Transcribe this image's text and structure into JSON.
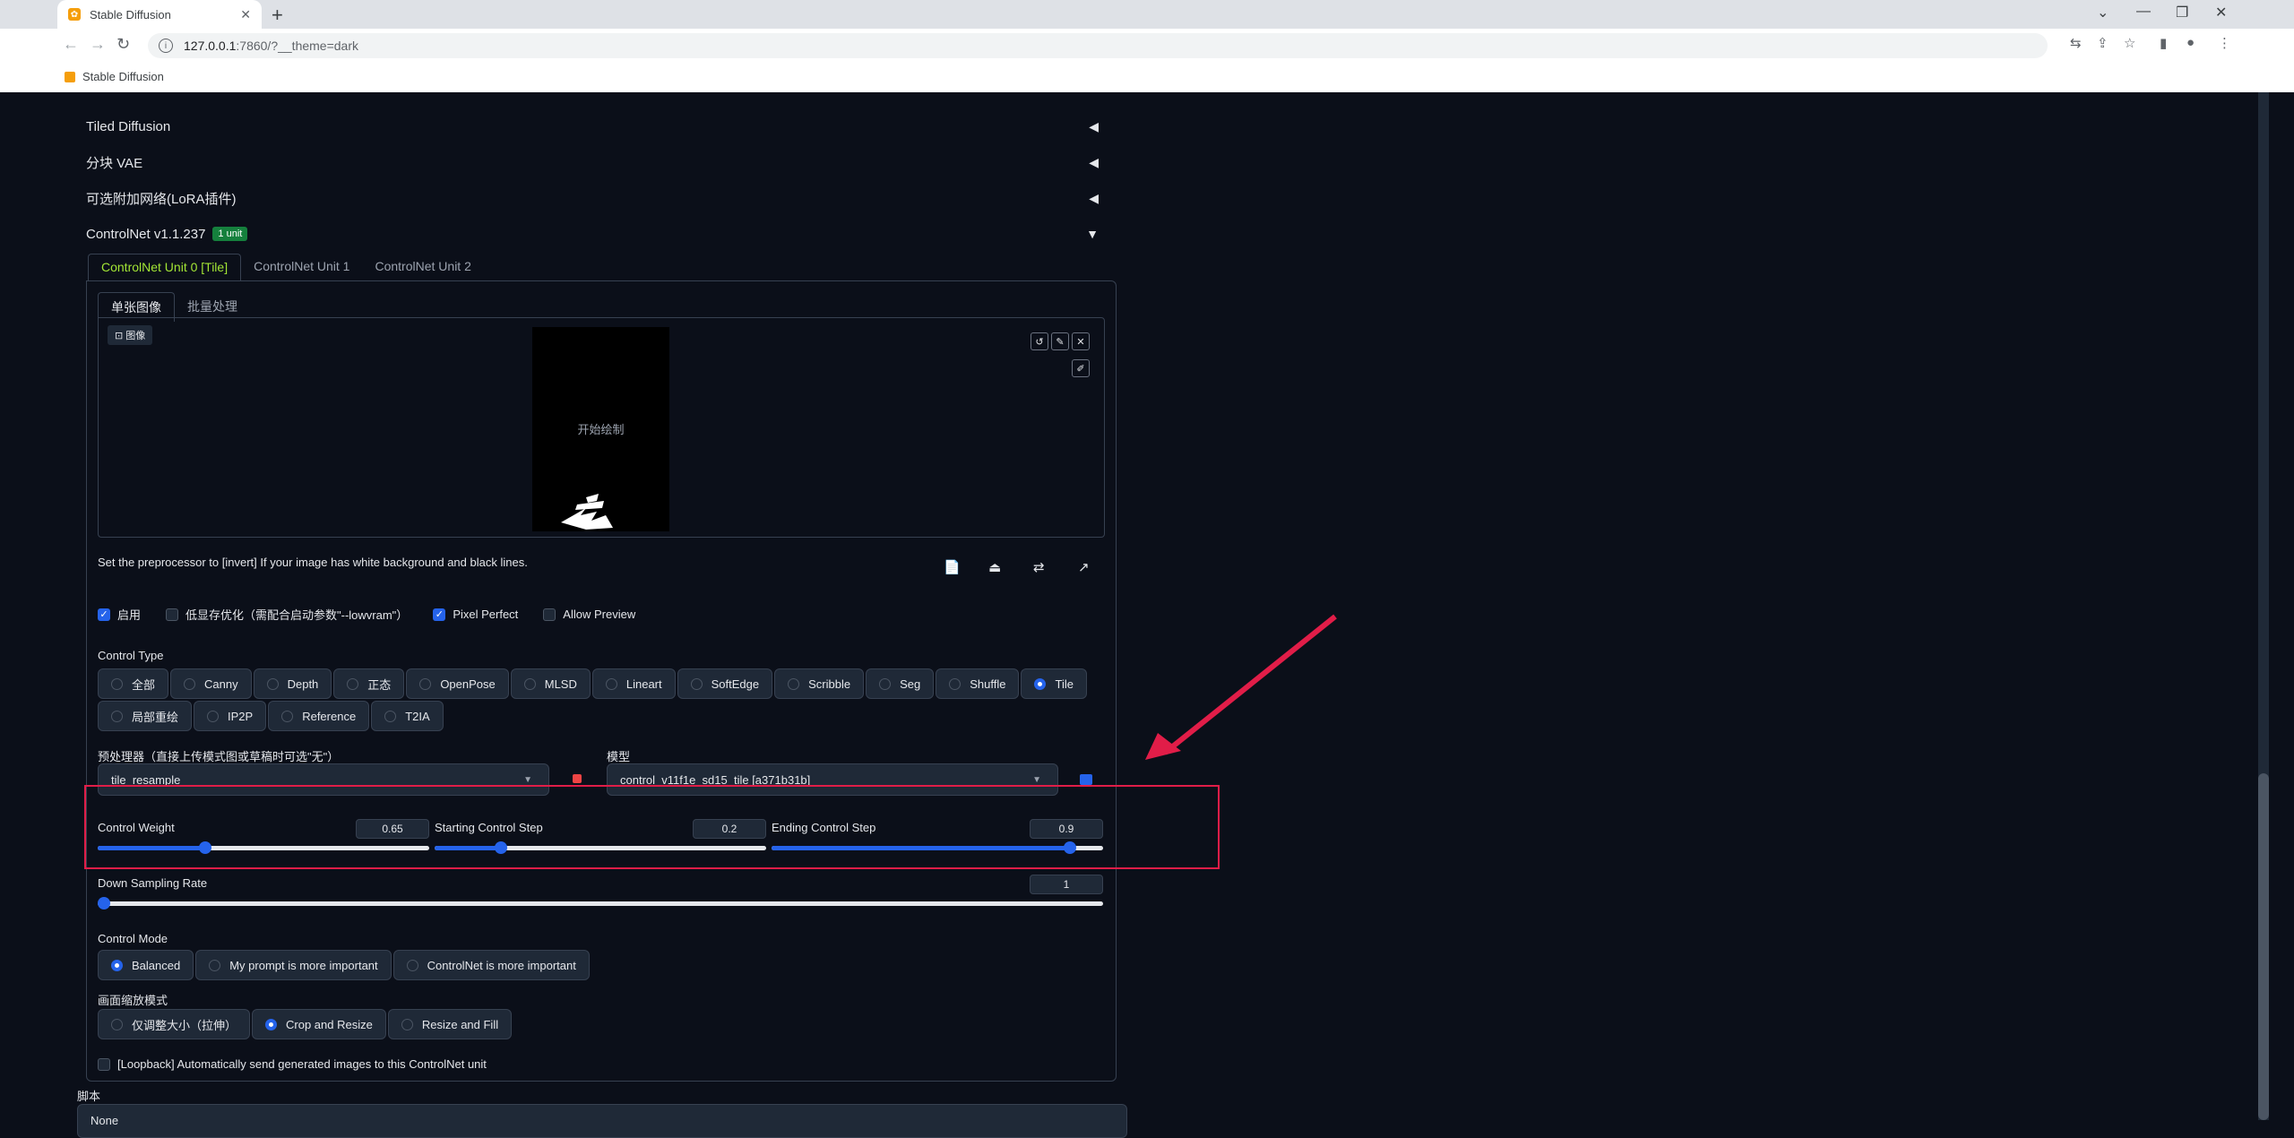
{
  "browser": {
    "tab_title": "Stable Diffusion",
    "url_host": "127.0.0.1",
    "url_rest": ":7860/?__theme=dark",
    "bookmark_label": "Stable Diffusion"
  },
  "accordions": [
    {
      "label": "Tiled Diffusion",
      "state": "◀"
    },
    {
      "label": "分块 VAE",
      "state": "◀"
    },
    {
      "label": "可选附加网络(LoRA插件)",
      "state": "◀"
    },
    {
      "label": "ControlNet v1.1.237",
      "badge": "1 unit",
      "state": "▼"
    }
  ],
  "cn_tabs": [
    "ControlNet Unit 0 [Tile]",
    "ControlNet Unit 1",
    "ControlNet Unit 2"
  ],
  "sub_tabs": [
    "单张图像",
    "批量处理"
  ],
  "image": {
    "label": "图像",
    "canvas_text": "开始绘制"
  },
  "hint": "Set the preprocessor to [invert] If your image has white background and black lines.",
  "options": {
    "enable": "启用",
    "lowvram": "低显存优化（需配合启动参数\"--lowvram\"）",
    "pixel_perfect": "Pixel Perfect",
    "allow_preview": "Allow Preview"
  },
  "control_type": {
    "label": "Control Type",
    "items": [
      "全部",
      "Canny",
      "Depth",
      "正态",
      "OpenPose",
      "MLSD",
      "Lineart",
      "SoftEdge",
      "Scribble",
      "Seg",
      "Shuffle",
      "Tile",
      "局部重绘",
      "IP2P",
      "Reference",
      "T2IA"
    ],
    "selected": "Tile"
  },
  "preprocessor": {
    "label": "预处理器（直接上传模式图或草稿时可选\"无\"）",
    "value": "tile_resample"
  },
  "model": {
    "label": "模型",
    "value": "control_v11f1e_sd15_tile [a371b31b]"
  },
  "sliders": {
    "weight": {
      "label": "Control Weight",
      "value": "0.65",
      "fraction": 0.325
    },
    "start": {
      "label": "Starting Control Step",
      "value": "0.2",
      "fraction": 0.2
    },
    "end": {
      "label": "Ending Control Step",
      "value": "0.9",
      "fraction": 0.9
    },
    "down": {
      "label": "Down Sampling Rate",
      "value": "1",
      "fraction": 0.0
    }
  },
  "control_mode": {
    "label": "Control Mode",
    "items": [
      "Balanced",
      "My prompt is more important",
      "ControlNet is more important"
    ],
    "selected": "Balanced"
  },
  "resize_mode": {
    "label": "画面缩放模式",
    "items": [
      "仅调整大小（拉伸）",
      "Crop and Resize",
      "Resize and Fill"
    ],
    "selected": "Crop and Resize"
  },
  "loopback": "[Loopback] Automatically send generated images to this ControlNet unit",
  "script": {
    "label": "脚本",
    "value": "None"
  },
  "colors": {
    "accent": "#2563eb",
    "annotation_red": "#e11d48",
    "badge_green": "#15803d"
  }
}
